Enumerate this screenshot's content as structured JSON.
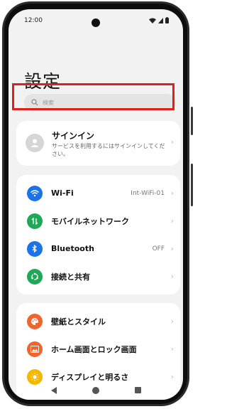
{
  "status_bar": {
    "time": "12:00"
  },
  "page_title": "設定",
  "search": {
    "placeholder": "検索"
  },
  "signin": {
    "title": "サインイン",
    "description": "サービスを利用するにはサインインしてください。"
  },
  "network_items": [
    {
      "label": "Wi-Fi",
      "value": "Int-WiFi-01",
      "icon": "wifi-icon",
      "color": "#1a73e8"
    },
    {
      "label": "モバイルネットワーク",
      "value": "",
      "icon": "mobile-data-icon",
      "color": "#1fa855"
    },
    {
      "label": "Bluetooth",
      "value": "OFF",
      "icon": "bluetooth-icon",
      "color": "#1a73e8"
    },
    {
      "label": "接続と共有",
      "value": "",
      "icon": "share-icon",
      "color": "#1fa855"
    }
  ],
  "display_items": [
    {
      "label": "壁紙とスタイル",
      "icon": "palette-icon",
      "color": "#f0642e"
    },
    {
      "label": "ホーム画面とロック画面",
      "icon": "image-icon",
      "color": "#f0642e"
    },
    {
      "label": "ディスプレイと明るさ",
      "icon": "brightness-icon",
      "color": "#f5b800"
    }
  ]
}
